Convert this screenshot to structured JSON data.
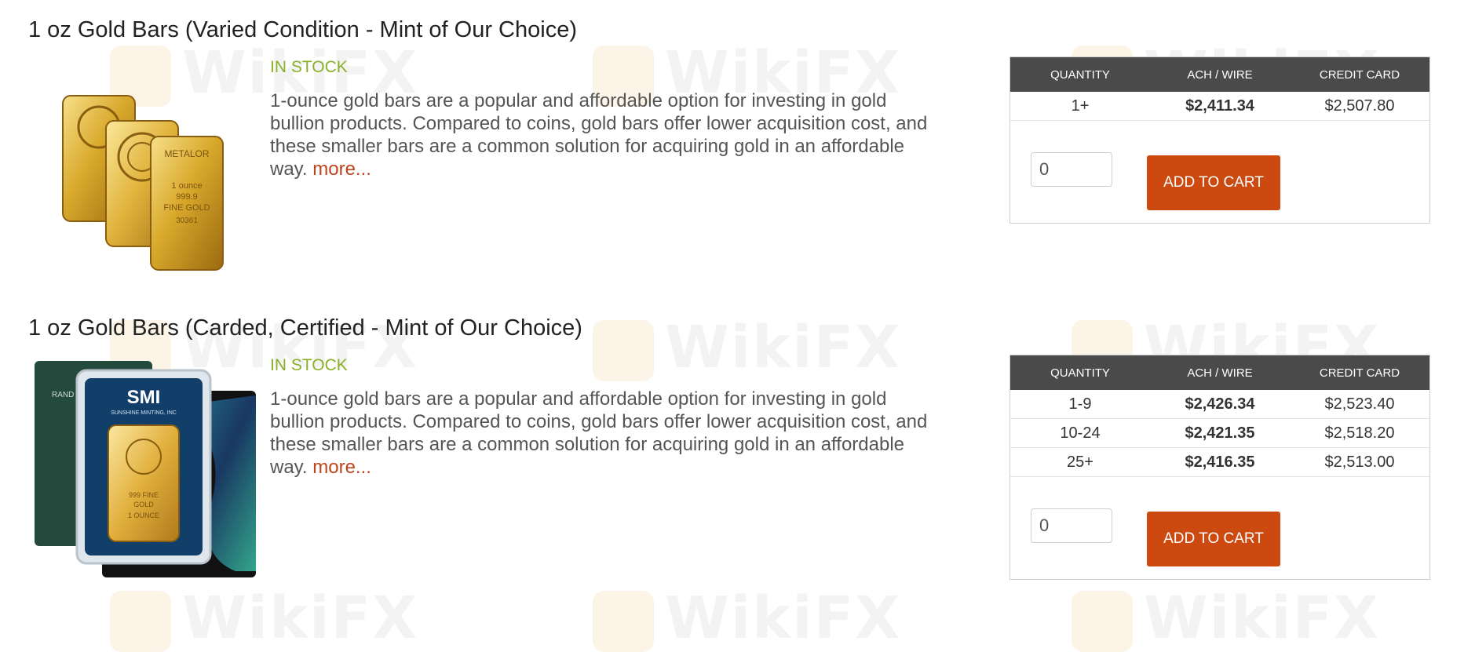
{
  "columns": {
    "quantity": "QUANTITY",
    "ach": "ACH / WIRE",
    "card": "CREDIT CARD"
  },
  "products": [
    {
      "title": "1 oz Gold Bars (Varied Condition - Mint of Our Choice)",
      "stock": "IN STOCK",
      "description": "1-ounce gold bars are a popular and affordable option for investing in gold bullion products. Compared to coins, gold bars offer lower acquisition cost, and these smaller bars are a common solution for acquiring gold in an affordable way.",
      "more": "more...",
      "tiers": [
        {
          "qty": "1+",
          "ach": "$2,411.34",
          "card": "$2,507.80"
        }
      ],
      "qty_value": "0",
      "cart_label": "ADD TO CART",
      "image_labels": {
        "metalor": "METALOR",
        "one_ounce": "1 ounce",
        "purity": "999.9",
        "fine_gold": "FINE GOLD",
        "serial": "30361"
      }
    },
    {
      "title": "1 oz Gold Bars (Carded, Certified - Mint of Our Choice)",
      "stock": "IN STOCK",
      "description": "1-ounce gold bars are a popular and affordable option for investing in gold bullion products. Compared to coins, gold bars offer lower acquisition cost, and these smaller bars are a common solution for acquiring gold in an affordable way.",
      "more": "more...",
      "tiers": [
        {
          "qty": "1-9",
          "ach": "$2,426.34",
          "card": "$2,523.40"
        },
        {
          "qty": "10-24",
          "ach": "$2,421.35",
          "card": "$2,518.20"
        },
        {
          "qty": "25+",
          "ach": "$2,416.35",
          "card": "$2,513.00"
        }
      ],
      "qty_value": "0",
      "cart_label": "ADD TO CART",
      "image_labels": {
        "brand": "SMI",
        "brand_sub": "SUNSHINE MINTING, INC",
        "rand": "RAND",
        "purity": "999 FINE",
        "gold": "GOLD",
        "ounce": "1 OUNCE"
      }
    }
  ],
  "watermark": "WikiFX",
  "colors": {
    "accent": "#cc4a10",
    "stock": "#8ab029",
    "header_bg": "#4a4a4a"
  }
}
